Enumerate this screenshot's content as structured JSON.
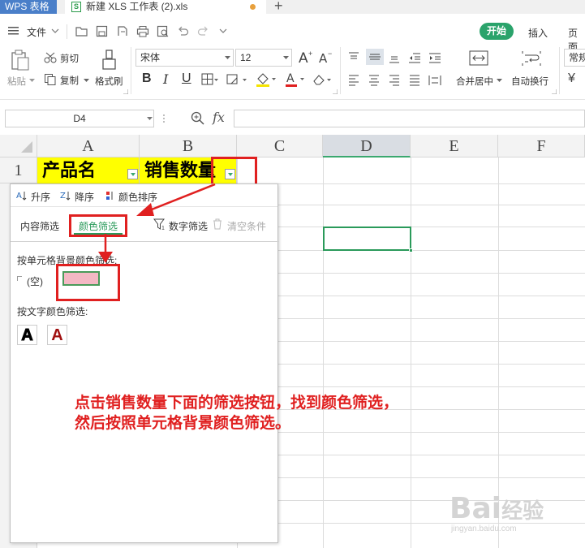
{
  "titlebar": {
    "app_tab": "WPS 表格",
    "doc_icon": "S",
    "doc_title": "新建 XLS 工作表 (2).xls",
    "new_tab": "+"
  },
  "menubar": {
    "file": "文件",
    "start": "开始",
    "insert": "插入",
    "page": "页面"
  },
  "ribbon": {
    "paste": "粘贴",
    "cut": "剪切",
    "copy": "复制",
    "format_painter": "格式刷",
    "font_name": "宋体",
    "font_size": "12",
    "bold": "B",
    "italic": "I",
    "underline": "U",
    "merge_center": "合并居中",
    "wrap_text": "自动换行",
    "number_format": "常规",
    "currency": "¥"
  },
  "formula_bar": {
    "name_box": "D4",
    "fx": "fx"
  },
  "sheet": {
    "columns": [
      "A",
      "B",
      "C",
      "D",
      "E",
      "F"
    ],
    "row1": "1",
    "cell_a1": "产品名",
    "cell_b1": "销售数量",
    "active_cell": "D4"
  },
  "filter_popup": {
    "sort_asc": "升序",
    "sort_desc": "降序",
    "sort_color": "颜色排序",
    "tab_content": "内容筛选",
    "tab_color": "颜色筛选",
    "number_filter": "数字筛选",
    "clear_filter": "清空条件",
    "bg_color_label": "按单元格背景颜色筛选:",
    "empty_option": "(空)",
    "bg_swatch_color": "#f4b8c4",
    "text_color_label": "按文字颜色筛选:",
    "text_swatch_black": "A",
    "text_swatch_red": "A"
  },
  "annotation": {
    "line1": "点击销售数量下面的筛选按钮，找到颜色筛选，",
    "line2": "然后按照单元格背景颜色筛选。"
  },
  "watermark": {
    "brand": "Bai",
    "brand2": "经验",
    "url": "jingyan.baidu.com"
  },
  "colors": {
    "accent_green": "#2aa36b",
    "header_yellow": "#ffff00",
    "annotation_red": "#e02020",
    "wps_blue": "#4a7fc9"
  }
}
